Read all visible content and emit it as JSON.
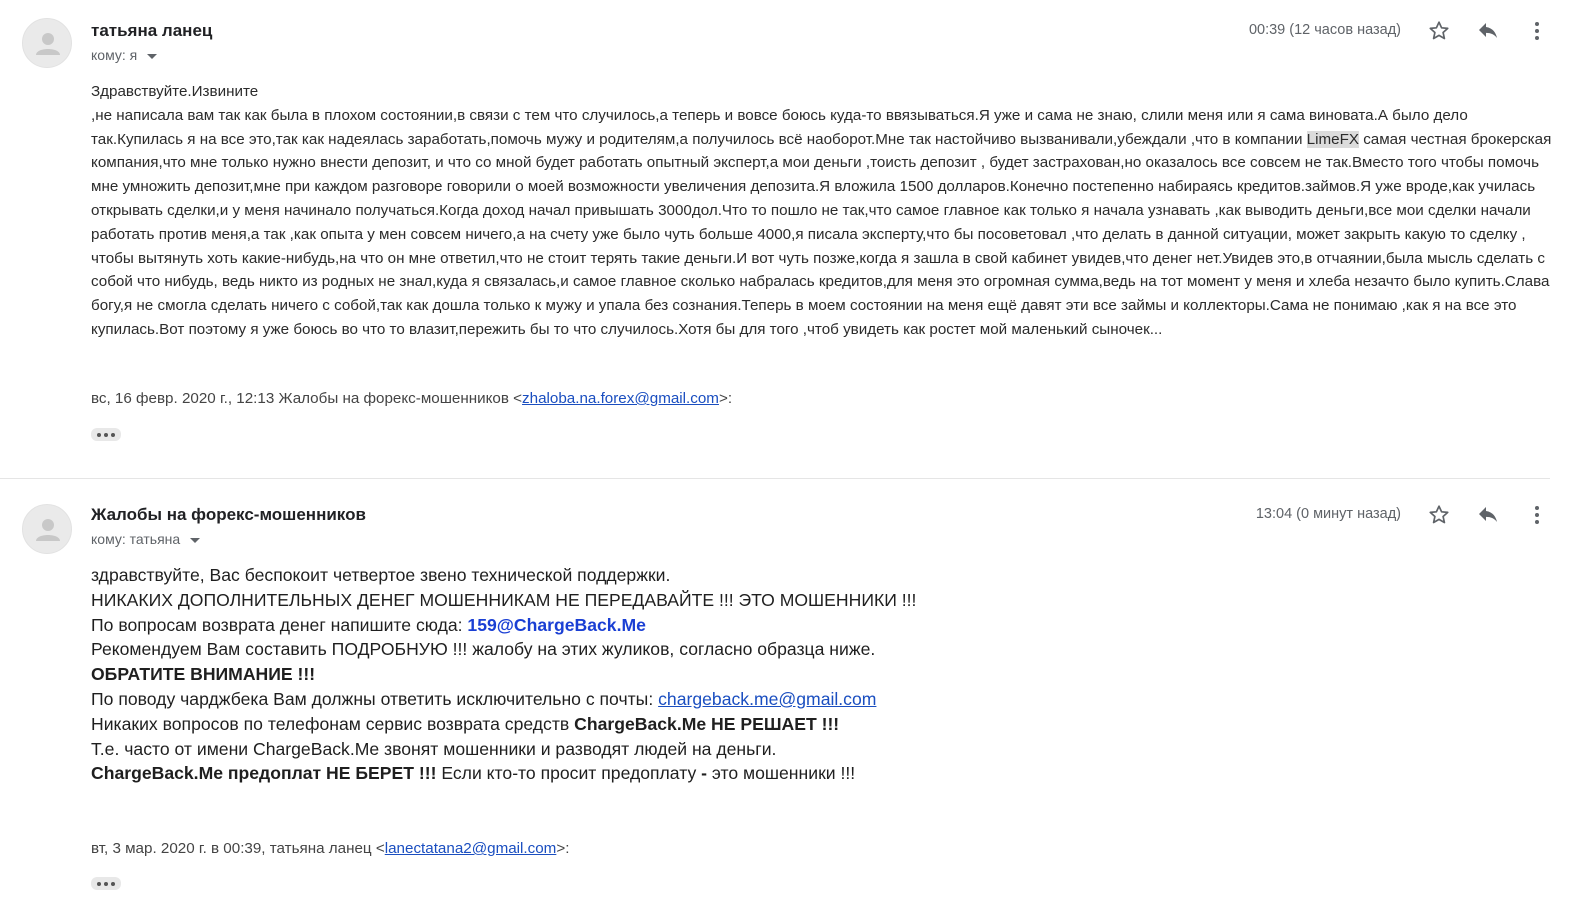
{
  "messages": [
    {
      "sender": "татьяна ланец",
      "recipient": "кому: я",
      "time": "00:39 (12 часов назад)",
      "body": {
        "greeting": "Здравствуйте.Извините",
        "text_before_highlight": ",не написала вам так как была в плохом состоянии,в связи с тем что случилось,а теперь и вовсе боюсь куда-то ввязываться.Я уже и сама не знаю, слили меня или я сама виновата.А было дело так.Купилась я на все это,так как надеялась заработать,помочь мужу и родителям,а получилось всё наоборот.Мне так настойчиво вызванивали,убеждали ,что в компании ",
        "highlight": "LimeFX",
        "text_after_highlight": " самая честная брокерская компания,что мне только нужно внести депозит, и что со мной будет работать опытный эксперт,а мои деньги ,тоисть депозит , будет застрахован,но оказалось все совсем не так.Вместо того чтобы помочь мне умножить депозит,мне при каждом разговоре говорили о моей возможности увеличения депозита.Я вложила 1500 долларов.Конечно постепенно набираясь кредитов.займов.Я уже вроде,как училась открывать сделки,и у меня начинало получаться.Когда доход начал привышать 3000дол.Что то пошло не так,что самое главное как только я начала узнавать ,как выводить деньги,все мои сделки начали работать против меня,а так ,как опыта у мен совсем ничего,а на счету уже было чуть больше 4000,я писала эксперту,что бы посоветовал ,что делать в данной ситуации, может закрыть какую то сделку , чтобы вытянуть хоть какие-нибудь,на что он мне  ответил,что не стоит терять такие деньги.И вот чуть позже,когда я зашла в свой кабинет увидев,что денег нет.Увидев это,в отчаянии,была мысль сделать с собой что нибудь, ведь никто из родных не знал,куда я связалась,и самое главное сколько набралась кредитов,для меня это огромная сумма,ведь на тот момент у меня и хлеба незачто было купить.Слава богу,я не смогла сделать ничего с собой,так как дошла только к мужу и упала без сознания.Теперь в моем состоянии на меня ещё давят эти все займы и коллекторы.Сама не понимаю ,как я на все это купилась.Вот поэтому я уже боюсь во что то влазит,пережить  бы  то что случилось.Хотя бы для того ,чтоб увидеть как ростет мой маленький сыночек..."
      },
      "quote_header": {
        "prefix": "вс, 16 февр. 2020 г., 12:13 Жалобы на форекс-мошенников <",
        "email": "zhaloba.na.forex@gmail.com",
        "suffix": ">:"
      }
    },
    {
      "sender": "Жалобы на форекс-мошенников",
      "recipient": "кому: татьяна",
      "time": "13:04 (0 минут назад)",
      "body": {
        "line1": "здравствуйте, Вас беспокоит четвертое звено технической поддержки.",
        "line2": "НИКАКИХ ДОПОЛНИТЕЛЬНЫХ ДЕНЕГ МОШЕННИКАМ НЕ ПЕРЕДАВАЙТЕ !!! ЭТО МОШЕННИКИ !!!",
        "line3_prefix": "По вопросам возврата денег напишите сюда: ",
        "line3_email": "159@ChargeBack.Me",
        "line4": "Рекомендуем Вам составить ПОДРОБНУЮ !!! жалобу на этих жуликов, согласно образца ниже.",
        "line5": "ОБРАТИТЕ ВНИМАНИЕ !!!",
        "line6_prefix": "По поводу чарджбека Вам должны ответить исключительно с почты: ",
        "line6_email": "chargeback.me@gmail.com",
        "line7_prefix": "Никаких вопросов по телефонам сервис возврата средств ",
        "line7_bold": "ChargeBack.Me НЕ РЕШАЕТ !!!",
        "line8": "Т.е. часто от имени ChargeBack.Me звонят мошенники и разводят людей на деньги.",
        "line9_bold1": "ChargeBack.Me предоплат НЕ БЕРЕТ !!!",
        "line9_middle": " Если кто-то просит предоплату ",
        "line9_dash": "-",
        "line9_suffix": " это мошенники !!!"
      },
      "quote_header": {
        "prefix": "вт, 3 мар. 2020 г. в 00:39, татьяна ланец <",
        "email": "lanectatana2@gmail.com",
        "suffix": ">:"
      }
    }
  ],
  "icons": {
    "avatar": "person-icon",
    "star": "star-icon",
    "reply": "reply-icon",
    "more": "more-vert-icon",
    "expand": "ellipsis-icon"
  },
  "colors": {
    "link": "#1a4ec0",
    "link_bold": "#1a3fd4",
    "highlight": "#dcdcdc",
    "meta": "#5f6368"
  }
}
